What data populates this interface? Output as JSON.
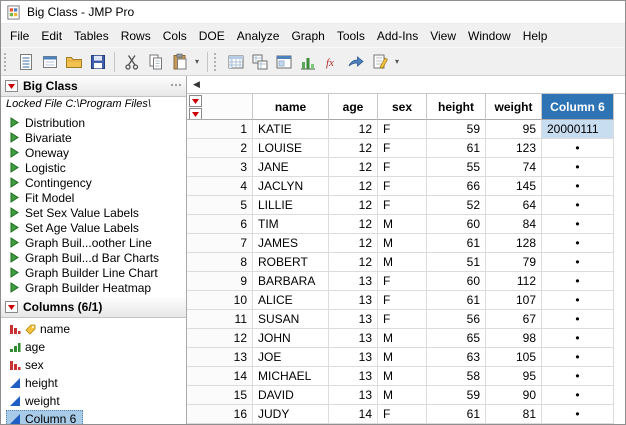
{
  "window": {
    "title": "Big Class - JMP Pro"
  },
  "glyphs": {
    "collapse": "◀",
    "overflow": "▾"
  },
  "colors": {
    "selected_header_bg": "#2e74b5",
    "selected_cell_bg": "#c9ddf1",
    "selected_item_bg": "#a8cbe8",
    "red_triangle": "#cc0000",
    "script_green": "#3f9e3f",
    "continuous_blue": "#1f5fc4",
    "nominal_red": "#c83232",
    "ordinal_green": "#2e8b2e"
  },
  "menubar": {
    "items": [
      "File",
      "Edit",
      "Tables",
      "Rows",
      "Cols",
      "DOE",
      "Analyze",
      "Graph",
      "Tools",
      "Add-Ins",
      "View",
      "Window",
      "Help"
    ]
  },
  "toolbar": {
    "groups": [
      {
        "name": "file",
        "icons": [
          "new-data-table-icon",
          "new-journal-icon",
          "open-icon",
          "save-icon"
        ]
      },
      {
        "name": "edit",
        "icons": [
          "cut-icon",
          "copy-icon",
          "paste-icon"
        ]
      },
      {
        "name": "jmp",
        "icons": [
          "data-table-icon",
          "join-tables-icon",
          "window-icon",
          "graph-builder-icon",
          "formula-icon",
          "share-icon",
          "script-icon"
        ]
      }
    ]
  },
  "sidebar": {
    "table_panel": {
      "title": "Big Class",
      "locked_label": "Locked File",
      "locked_path": "C:\\Program Files\\",
      "scripts": [
        "Distribution",
        "Bivariate",
        "Oneway",
        "Logistic",
        "Contingency",
        "Fit Model",
        "Set Sex Value Labels",
        "Set Age Value Labels",
        "Graph Buil...oother Line",
        "Graph Buil...d Bar Charts",
        "Graph Builder Line Chart",
        "Graph Builder Heatmap"
      ]
    },
    "columns_panel": {
      "title": "Columns (6/1)",
      "items": [
        {
          "label": "name",
          "type": "nominal",
          "labeled": true
        },
        {
          "label": "age",
          "type": "ordinal"
        },
        {
          "label": "sex",
          "type": "nominal"
        },
        {
          "label": "height",
          "type": "continuous"
        },
        {
          "label": "weight",
          "type": "continuous"
        },
        {
          "label": "Column 6",
          "type": "continuous",
          "selected": true
        }
      ]
    }
  },
  "table": {
    "columns": [
      {
        "key": "name",
        "label": "name"
      },
      {
        "key": "age",
        "label": "age"
      },
      {
        "key": "sex",
        "label": "sex"
      },
      {
        "key": "height",
        "label": "height"
      },
      {
        "key": "weight",
        "label": "weight"
      },
      {
        "key": "col6",
        "label": "Column 6",
        "selected": true
      }
    ],
    "missing_marker": "•",
    "rows": [
      {
        "n": "1",
        "name": "KATIE",
        "age": "12",
        "sex": "F",
        "height": "59",
        "weight": "95",
        "col6": "20000111",
        "col6_selected": true
      },
      {
        "n": "2",
        "name": "LOUISE",
        "age": "12",
        "sex": "F",
        "height": "61",
        "weight": "123",
        "col6": "•"
      },
      {
        "n": "3",
        "name": "JANE",
        "age": "12",
        "sex": "F",
        "height": "55",
        "weight": "74",
        "col6": "•"
      },
      {
        "n": "4",
        "name": "JACLYN",
        "age": "12",
        "sex": "F",
        "height": "66",
        "weight": "145",
        "col6": "•"
      },
      {
        "n": "5",
        "name": "LILLIE",
        "age": "12",
        "sex": "F",
        "height": "52",
        "weight": "64",
        "col6": "•"
      },
      {
        "n": "6",
        "name": "TIM",
        "age": "12",
        "sex": "M",
        "height": "60",
        "weight": "84",
        "col6": "•"
      },
      {
        "n": "7",
        "name": "JAMES",
        "age": "12",
        "sex": "M",
        "height": "61",
        "weight": "128",
        "col6": "•"
      },
      {
        "n": "8",
        "name": "ROBERT",
        "age": "12",
        "sex": "M",
        "height": "51",
        "weight": "79",
        "col6": "•"
      },
      {
        "n": "9",
        "name": "BARBARA",
        "age": "13",
        "sex": "F",
        "height": "60",
        "weight": "112",
        "col6": "•"
      },
      {
        "n": "10",
        "name": "ALICE",
        "age": "13",
        "sex": "F",
        "height": "61",
        "weight": "107",
        "col6": "•"
      },
      {
        "n": "11",
        "name": "SUSAN",
        "age": "13",
        "sex": "F",
        "height": "56",
        "weight": "67",
        "col6": "•"
      },
      {
        "n": "12",
        "name": "JOHN",
        "age": "13",
        "sex": "M",
        "height": "65",
        "weight": "98",
        "col6": "•"
      },
      {
        "n": "13",
        "name": "JOE",
        "age": "13",
        "sex": "M",
        "height": "63",
        "weight": "105",
        "col6": "•"
      },
      {
        "n": "14",
        "name": "MICHAEL",
        "age": "13",
        "sex": "M",
        "height": "58",
        "weight": "95",
        "col6": "•"
      },
      {
        "n": "15",
        "name": "DAVID",
        "age": "13",
        "sex": "M",
        "height": "59",
        "weight": "90",
        "col6": "•"
      },
      {
        "n": "16",
        "name": "JUDY",
        "age": "14",
        "sex": "F",
        "height": "61",
        "weight": "81",
        "col6": "•"
      }
    ]
  }
}
